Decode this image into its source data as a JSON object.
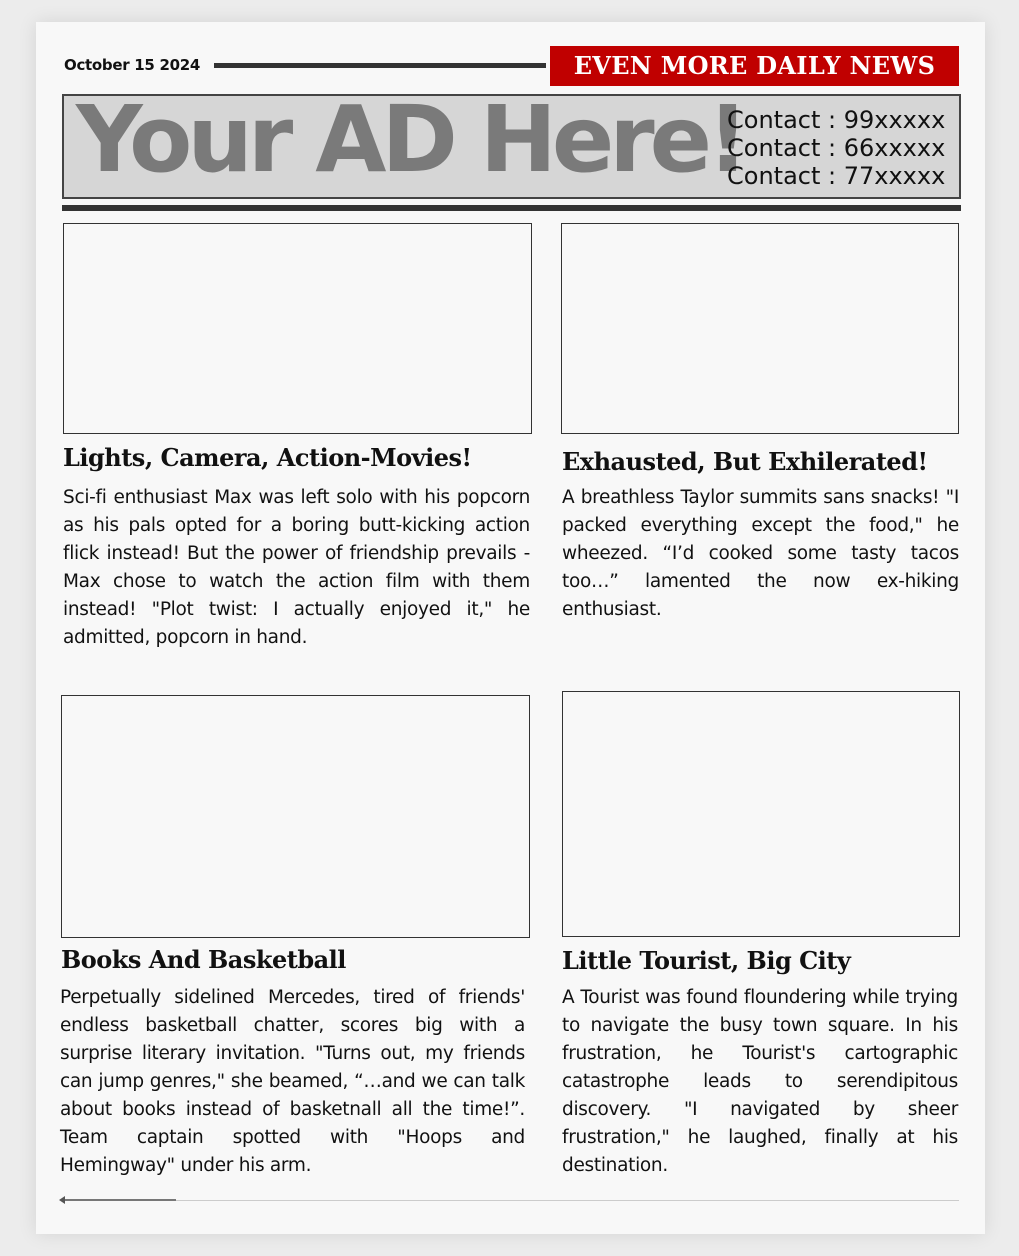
{
  "header": {
    "date": "October 15 2024",
    "masthead": "EVEN MORE DAILY NEWS"
  },
  "ad": {
    "headline": "Your AD Here!",
    "contacts": [
      "Contact : 99xxxxx",
      "Contact : 66xxxxx",
      "Contact : 77xxxxx"
    ]
  },
  "articles": [
    {
      "title": "Lights, Camera, Action-Movies!",
      "body": "Sci-fi enthusiast Max was left solo with his popcorn as his pals opted for a boring butt-kicking action flick instead! But the power of friendship prevails - Max chose to watch the action film with them instead! \"Plot twist: I actually enjoyed it,\" he admitted, popcorn in hand."
    },
    {
      "title": "Exhausted, But Exhilerated!",
      "body": "A breathless Taylor summits sans snacks! \"I packed everything except the food,\" he wheezed. “I’d cooked some tasty tacos too…” lamented the now ex-hiking enthusiast."
    },
    {
      "title": "Books And Basketball",
      "body": "Perpetually sidelined Mercedes, tired of friends' endless basketball chatter, scores big with a surprise literary invitation. \"Turns out, my friends can jump genres,\" she beamed, “…and we can talk about books instead of basketnall all the time!”. Team captain spotted with \"Hoops and Hemingway\" under his arm."
    },
    {
      "title": "Little Tourist, Big City",
      "body": "A Tourist was found floundering while trying to navigate the busy town square. In his frustration, he Tourist's cartographic catastrophe leads to serendipitous discovery. \"I navigated by sheer frustration,\" he laughed, finally at his destination."
    }
  ]
}
